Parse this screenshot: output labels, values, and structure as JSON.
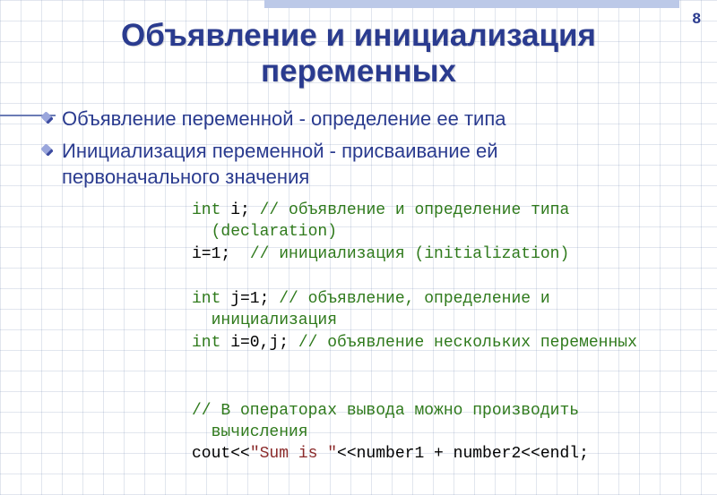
{
  "page_number": "8",
  "title_line1": "Объявление и инициализация",
  "title_line2": "переменных",
  "bullets": {
    "b1": "Объявление переменной - определение ее типа",
    "b2_a": "Инициализация переменной - присваивание ей",
    "b2_b": "первоначального значения"
  },
  "code": {
    "l1_kw": "int",
    "l1_rest": " i; ",
    "l1_cm": "// объявление и определение типа",
    "l1_cont_cm": "(declaration)",
    "l2_code": "i=1;  ",
    "l2_cm": "// инициализация (initialization)",
    "l3_kw": "int",
    "l3_rest": " j=1; ",
    "l3_cm": "// объявление, определение и",
    "l3_cont_cm": "инициализация",
    "l4_kw": "int",
    "l4_rest": " i=0,j; ",
    "l4_cm": "// объявление нескольких переменных",
    "l5_cm_a": "// В операторах вывода можно производить",
    "l5_cm_b": "вычисления",
    "l6_a": "cout<<",
    "l6_str": "\"Sum is \"",
    "l6_b": "<<number1 + number2<<endl;"
  }
}
